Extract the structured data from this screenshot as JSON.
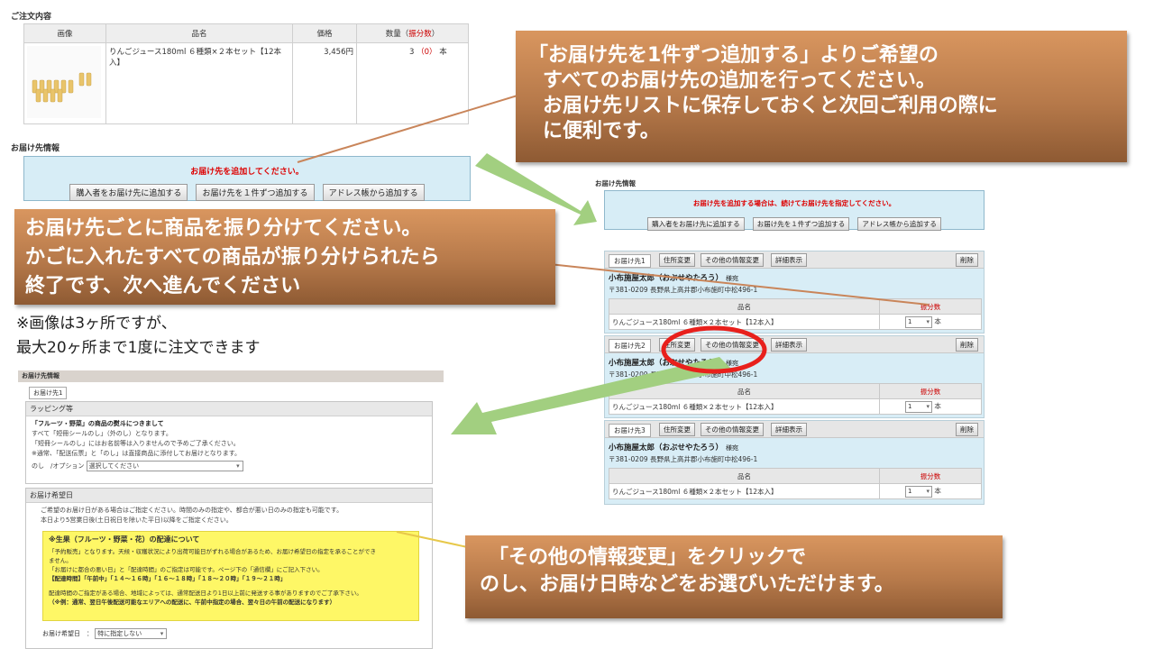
{
  "order": {
    "title": "ご注文内容",
    "headers": [
      "画像",
      "品名",
      "価格",
      "数量（",
      "振分数",
      "）"
    ],
    "item_name": "りんごジュース180ml ６種類×２本セット【12本入】",
    "price": "3,456円",
    "qty": "3",
    "qty_alloc": "（0）",
    "qty_unit": "本"
  },
  "delivery": {
    "title": "お届け先情報",
    "alert": "お届け先を追加してください。",
    "buttons": [
      "購入者をお届け先に追加する",
      "お届け先を１件ずつ追加する",
      "アドレス帳から追加する"
    ]
  },
  "right": {
    "title": "お届け先情報",
    "alert": "お届け先を追加する場合は、続けてお届け先を指定してください。",
    "buttons": [
      "購入者をお届け先に追加する",
      "お届け先を１件ずつ追加する",
      "アドレス帳から追加する"
    ],
    "block_buttons": [
      "住所変更",
      "その他の情報変更",
      "詳細表示"
    ],
    "delete": "削除",
    "col_name": "品名",
    "col_alloc": "振分数",
    "blocks": [
      {
        "tab": "お届け先1",
        "name": "小布施屋太郎（おぶせやたろう）",
        "sama": "様宛",
        "postal": "〒381-0209 長野県上高井郡小布施町中松496-1",
        "item": "りんごジュース180ml ６種類×２本セット【12本入】",
        "qty": "1",
        "unit": "本"
      },
      {
        "tab": "お届け先2",
        "name": "小布施屋太郎（おぶせやたろう）",
        "sama": "様宛",
        "postal": "〒381-0209 長野県上高井郡小布施町中松496-1",
        "item": "りんごジュース180ml ６種類×２本セット【12本入】",
        "qty": "1",
        "unit": "本"
      },
      {
        "tab": "お届け先3",
        "name": "小布施屋太郎（おぶせやたろう）",
        "sama": "様宛",
        "postal": "〒381-0209 長野県上高井郡小布施町中松496-1",
        "item": "りんごジュース180ml ６種類×２本セット【12本入】",
        "qty": "1",
        "unit": "本"
      }
    ]
  },
  "callouts": {
    "c1": [
      "「お届け先を1件ずつ追加する」よりご希望の",
      "すべてのお届け先の追加を行ってください。",
      "お届け先リストに保存しておくと次回ご利用の際に",
      "に便利です。"
    ],
    "c2": [
      "お届け先ごとに商品を振り分けてください。",
      "かごに入れたすべての商品が振り分けられたら",
      "終了です、次へ進んでください"
    ],
    "c3": [
      "「その他の情報変更」をクリックで",
      "のし、お届け日時などをお選びいただけます。"
    ]
  },
  "note": [
    "※画像は3ヶ所ですが、",
    "最大20ヶ所まで1度に注文できます"
  ],
  "bottom": {
    "title": "お届け先情報",
    "tab": "お届け先1",
    "wrap_header": "ラッピング等",
    "wrap_lines": [
      "「フルーツ・野菜」の商品の熨斗につきまして",
      "すべて「短冊シールのし」（外のし）となります。",
      "「短冊シールのし」にはお名前等は入りませんので予めご了承ください。",
      "※通常、「配送伝票」と「のし」は直接商品に添付してお届けとなります。"
    ],
    "noshi_label": "のし　/オプション",
    "noshi_value": "選択してください",
    "date_header": "お届け希望日",
    "date_lines": [
      "ご希望のお届け日がある場合はご指定ください。時間のみの指定や、都合が悪い日のみの指定も可能です。",
      "本日より5営業日後(土日祝日を除いた平日)以降をご指定ください。"
    ],
    "y_title": "※生果（フルーツ・野菜・花）の配達について",
    "y_lines": [
      "「予約販売」となります。天候・収穫状況により出荷可能日がずれる場合があるため、お届け希望日の指定を承ることができ",
      "ません。",
      "「お届けに都合の悪い日」と「配達時間」のご指定は可能です。ページ下の「通信欄」にご記入下さい。",
      "【配達時間】「午前中」「１４～１６時」「１６～１８時」「１８～２０時」「１９～２１時」",
      "",
      "配達時間のご指定がある場合、地域によっては、通常配送日より1日以上前に発送する事がありますのでご了承下さい。",
      "（※例：通常、翌日午後配送可能なエリアへの配送に、午前中指定の場合、翌々日の午前の配送になります）"
    ],
    "date_label": "お届け希望日　：",
    "date_value": "特に指定しない"
  }
}
